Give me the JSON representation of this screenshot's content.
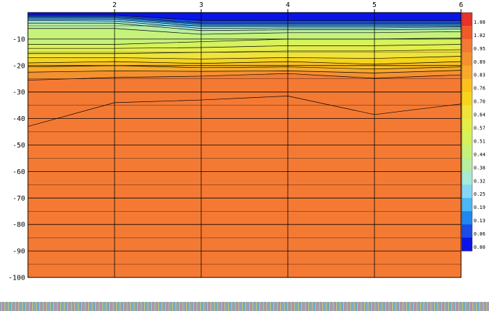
{
  "chart_data": {
    "type": "heatmap",
    "x_ticks": [
      2,
      3,
      4,
      5,
      6
    ],
    "x_range": [
      1,
      6
    ],
    "y_ticks": [
      -10,
      -20,
      -30,
      -40,
      -50,
      -60,
      -70,
      -80,
      -90,
      -100
    ],
    "y_range": [
      -100,
      0
    ],
    "colorbar": {
      "labels": [
        "1.08",
        "1.02",
        "0.95",
        "0.89",
        "0.83",
        "0.76",
        "0.70",
        "0.64",
        "0.57",
        "0.51",
        "0.44",
        "0.38",
        "0.32",
        "0.25",
        "0.19",
        "0.13",
        "0.06",
        "0.00"
      ],
      "colors": [
        "#e8322a",
        "#f05a2a",
        "#f47a34",
        "#f49030",
        "#f8a82a",
        "#fcc01c",
        "#f6d41c",
        "#f0e43a",
        "#e4ee4a",
        "#d6f25c",
        "#c6f27a",
        "#b8eea0",
        "#a6ecd6",
        "#84d8f6",
        "#4cb6f6",
        "#1e88f0",
        "#1a4ce8",
        "#0a14e6"
      ]
    },
    "contours": {
      "x": [
        1,
        2,
        3,
        4,
        5,
        6
      ],
      "levels": [
        {
          "y": [
            -1.0,
            -1.0,
            -3.0,
            -3.0,
            -3.0,
            -3.0
          ],
          "color": "#0a14e6"
        },
        {
          "y": [
            -1.5,
            -1.5,
            -4.0,
            -4.0,
            -4.0,
            -4.0
          ],
          "color": "#1a4ce8"
        },
        {
          "y": [
            -2.0,
            -2.0,
            -4.5,
            -4.5,
            -4.5,
            -4.5
          ],
          "color": "#1e88f0"
        },
        {
          "y": [
            -2.5,
            -2.5,
            -5.2,
            -5.2,
            -5.2,
            -5.2
          ],
          "color": "#4cb6f6"
        },
        {
          "y": [
            -3.0,
            -3.2,
            -6.0,
            -5.8,
            -5.8,
            -5.5
          ],
          "color": "#84d8f6"
        },
        {
          "y": [
            -4.0,
            -4.0,
            -6.8,
            -6.5,
            -6.5,
            -6.2
          ],
          "color": "#a6ecd6"
        },
        {
          "y": [
            -6.0,
            -6.0,
            -8.2,
            -7.6,
            -7.6,
            -7.2
          ],
          "color": "#b8eea0"
        },
        {
          "y": [
            -12.0,
            -12.0,
            -11.0,
            -10.0,
            -10.0,
            -9.6
          ],
          "color": "#c6f27a"
        },
        {
          "y": [
            -13.5,
            -13.5,
            -13.2,
            -12.5,
            -12.5,
            -12.0
          ],
          "color": "#d6f25c"
        },
        {
          "y": [
            -15.5,
            -15.5,
            -15.0,
            -14.5,
            -14.5,
            -14.0
          ],
          "color": "#e4ee4a"
        },
        {
          "y": [
            -17.0,
            -17.0,
            -17.5,
            -17.0,
            -17.3,
            -16.5
          ],
          "color": "#f0e43a"
        },
        {
          "y": [
            -19.0,
            -18.5,
            -19.2,
            -18.5,
            -19.5,
            -18.5
          ],
          "color": "#f6d41c"
        },
        {
          "y": [
            -20.5,
            -20.0,
            -20.8,
            -20.5,
            -21.3,
            -20.5
          ],
          "color": "#fcc01c"
        },
        {
          "y": [
            -22.5,
            -22.0,
            -22.2,
            -22.0,
            -22.8,
            -21.8
          ],
          "color": "#f8a82a"
        },
        {
          "y": [
            -25.5,
            -24.5,
            -24.0,
            -23.0,
            -24.8,
            -23.5
          ],
          "color": "#f49030"
        },
        {
          "y": [
            -43.0,
            -34.0,
            -33.0,
            -31.5,
            -38.5,
            -34.5
          ],
          "color": "#f47a34"
        }
      ]
    }
  }
}
